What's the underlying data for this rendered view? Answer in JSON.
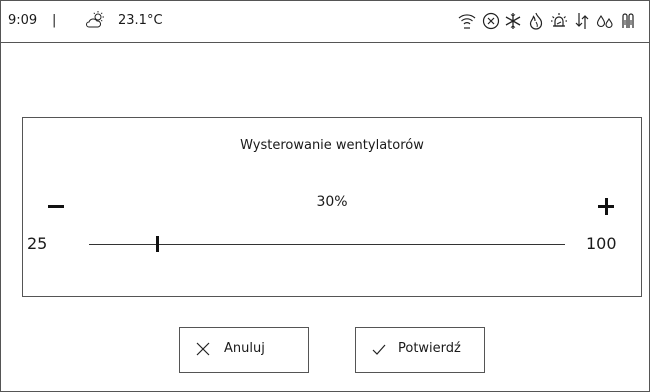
{
  "status_bar": {
    "time": "9:09",
    "separator": "|",
    "temperature": "23.1°C",
    "icons": [
      "partly-cloudy-icon",
      "wifi-icon",
      "circle-x-icon",
      "snowflake-icon",
      "flame-icon",
      "alarm-icon",
      "fan-arrows-icon",
      "water-drops-icon",
      "thermometer-probe-icon"
    ]
  },
  "dialog": {
    "title": "Wysterowanie wentylatorów",
    "value_text": "30%",
    "min": "25",
    "max": "100",
    "slider_value": 30,
    "slider_min": 25,
    "slider_max": 100
  },
  "buttons": {
    "cancel_label": "Anuluj",
    "confirm_label": "Potwierdź"
  },
  "colors": {
    "border": "#555555",
    "text": "#1a1a1a",
    "background": "#ffffff"
  }
}
